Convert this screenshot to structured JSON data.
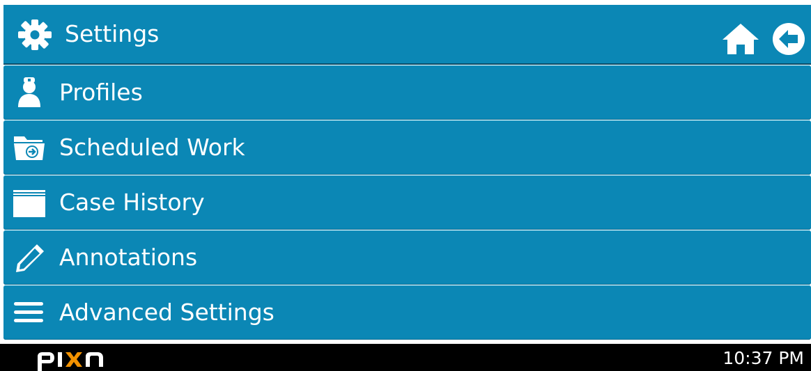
{
  "colors": {
    "accent": "#0b87b5",
    "footer_bg": "#000000",
    "text": "#ffffff",
    "logo_highlight": "#f39200"
  },
  "header": {
    "title": "Settings",
    "title_icon": "gear-icon",
    "right_icons": [
      "home-icon",
      "back-arrow-icon"
    ]
  },
  "menu": {
    "items": [
      {
        "label": "Profiles",
        "icon": "doctor-profile-icon"
      },
      {
        "label": "Scheduled Work",
        "icon": "folder-arrow-icon"
      },
      {
        "label": "Case History",
        "icon": "file-box-icon"
      },
      {
        "label": "Annotations",
        "icon": "pencil-icon"
      },
      {
        "label": "Advanced Settings",
        "icon": "hamburger-menu-icon"
      }
    ]
  },
  "footer": {
    "logo": "pixa",
    "time": "10:37 PM"
  }
}
